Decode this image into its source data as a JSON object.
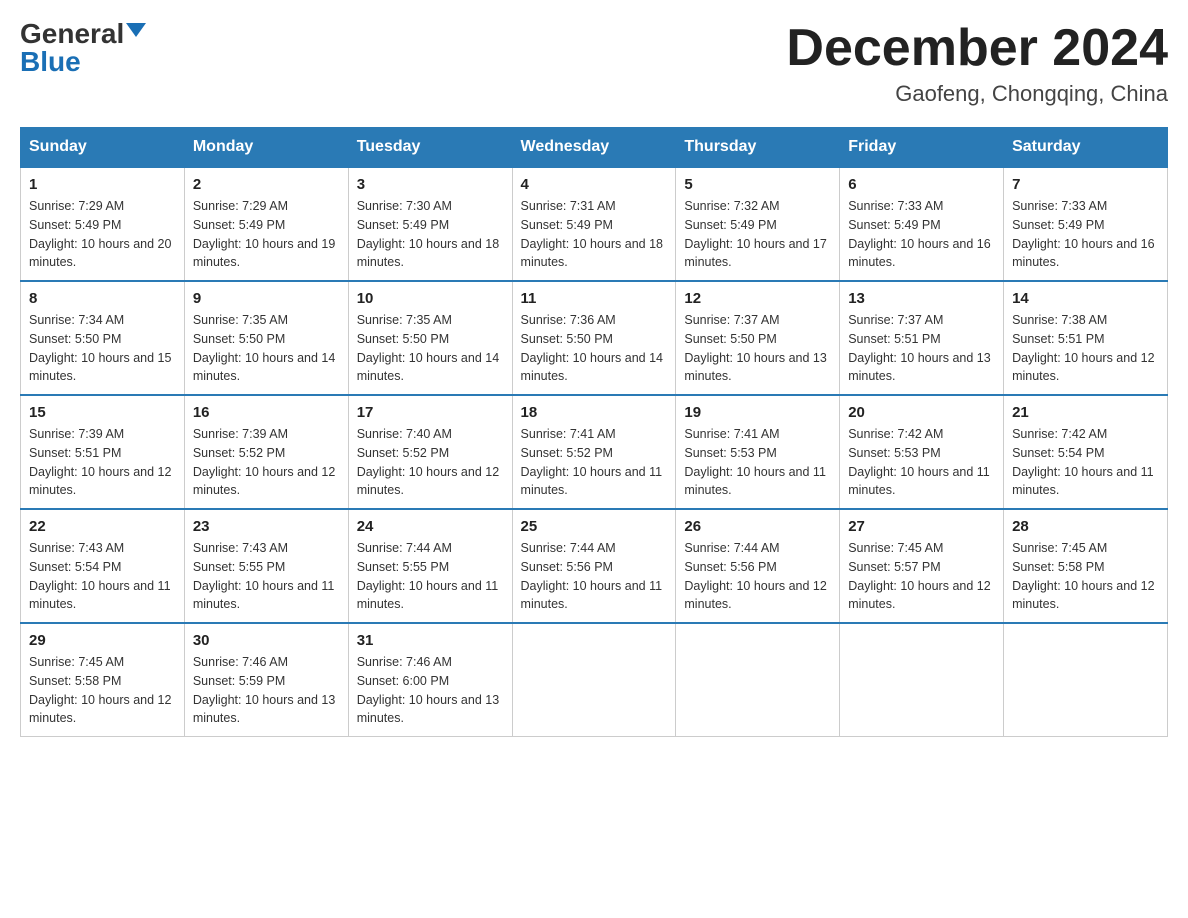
{
  "header": {
    "logo_general": "General",
    "logo_blue": "Blue",
    "month_year": "December 2024",
    "location": "Gaofeng, Chongqing, China"
  },
  "days_of_week": [
    "Sunday",
    "Monday",
    "Tuesday",
    "Wednesday",
    "Thursday",
    "Friday",
    "Saturday"
  ],
  "weeks": [
    [
      {
        "day": "1",
        "sunrise": "7:29 AM",
        "sunset": "5:49 PM",
        "daylight": "10 hours and 20 minutes."
      },
      {
        "day": "2",
        "sunrise": "7:29 AM",
        "sunset": "5:49 PM",
        "daylight": "10 hours and 19 minutes."
      },
      {
        "day": "3",
        "sunrise": "7:30 AM",
        "sunset": "5:49 PM",
        "daylight": "10 hours and 18 minutes."
      },
      {
        "day": "4",
        "sunrise": "7:31 AM",
        "sunset": "5:49 PM",
        "daylight": "10 hours and 18 minutes."
      },
      {
        "day": "5",
        "sunrise": "7:32 AM",
        "sunset": "5:49 PM",
        "daylight": "10 hours and 17 minutes."
      },
      {
        "day": "6",
        "sunrise": "7:33 AM",
        "sunset": "5:49 PM",
        "daylight": "10 hours and 16 minutes."
      },
      {
        "day": "7",
        "sunrise": "7:33 AM",
        "sunset": "5:49 PM",
        "daylight": "10 hours and 16 minutes."
      }
    ],
    [
      {
        "day": "8",
        "sunrise": "7:34 AM",
        "sunset": "5:50 PM",
        "daylight": "10 hours and 15 minutes."
      },
      {
        "day": "9",
        "sunrise": "7:35 AM",
        "sunset": "5:50 PM",
        "daylight": "10 hours and 14 minutes."
      },
      {
        "day": "10",
        "sunrise": "7:35 AM",
        "sunset": "5:50 PM",
        "daylight": "10 hours and 14 minutes."
      },
      {
        "day": "11",
        "sunrise": "7:36 AM",
        "sunset": "5:50 PM",
        "daylight": "10 hours and 14 minutes."
      },
      {
        "day": "12",
        "sunrise": "7:37 AM",
        "sunset": "5:50 PM",
        "daylight": "10 hours and 13 minutes."
      },
      {
        "day": "13",
        "sunrise": "7:37 AM",
        "sunset": "5:51 PM",
        "daylight": "10 hours and 13 minutes."
      },
      {
        "day": "14",
        "sunrise": "7:38 AM",
        "sunset": "5:51 PM",
        "daylight": "10 hours and 12 minutes."
      }
    ],
    [
      {
        "day": "15",
        "sunrise": "7:39 AM",
        "sunset": "5:51 PM",
        "daylight": "10 hours and 12 minutes."
      },
      {
        "day": "16",
        "sunrise": "7:39 AM",
        "sunset": "5:52 PM",
        "daylight": "10 hours and 12 minutes."
      },
      {
        "day": "17",
        "sunrise": "7:40 AM",
        "sunset": "5:52 PM",
        "daylight": "10 hours and 12 minutes."
      },
      {
        "day": "18",
        "sunrise": "7:41 AM",
        "sunset": "5:52 PM",
        "daylight": "10 hours and 11 minutes."
      },
      {
        "day": "19",
        "sunrise": "7:41 AM",
        "sunset": "5:53 PM",
        "daylight": "10 hours and 11 minutes."
      },
      {
        "day": "20",
        "sunrise": "7:42 AM",
        "sunset": "5:53 PM",
        "daylight": "10 hours and 11 minutes."
      },
      {
        "day": "21",
        "sunrise": "7:42 AM",
        "sunset": "5:54 PM",
        "daylight": "10 hours and 11 minutes."
      }
    ],
    [
      {
        "day": "22",
        "sunrise": "7:43 AM",
        "sunset": "5:54 PM",
        "daylight": "10 hours and 11 minutes."
      },
      {
        "day": "23",
        "sunrise": "7:43 AM",
        "sunset": "5:55 PM",
        "daylight": "10 hours and 11 minutes."
      },
      {
        "day": "24",
        "sunrise": "7:44 AM",
        "sunset": "5:55 PM",
        "daylight": "10 hours and 11 minutes."
      },
      {
        "day": "25",
        "sunrise": "7:44 AM",
        "sunset": "5:56 PM",
        "daylight": "10 hours and 11 minutes."
      },
      {
        "day": "26",
        "sunrise": "7:44 AM",
        "sunset": "5:56 PM",
        "daylight": "10 hours and 12 minutes."
      },
      {
        "day": "27",
        "sunrise": "7:45 AM",
        "sunset": "5:57 PM",
        "daylight": "10 hours and 12 minutes."
      },
      {
        "day": "28",
        "sunrise": "7:45 AM",
        "sunset": "5:58 PM",
        "daylight": "10 hours and 12 minutes."
      }
    ],
    [
      {
        "day": "29",
        "sunrise": "7:45 AM",
        "sunset": "5:58 PM",
        "daylight": "10 hours and 12 minutes."
      },
      {
        "day": "30",
        "sunrise": "7:46 AM",
        "sunset": "5:59 PM",
        "daylight": "10 hours and 13 minutes."
      },
      {
        "day": "31",
        "sunrise": "7:46 AM",
        "sunset": "6:00 PM",
        "daylight": "10 hours and 13 minutes."
      },
      null,
      null,
      null,
      null
    ]
  ]
}
